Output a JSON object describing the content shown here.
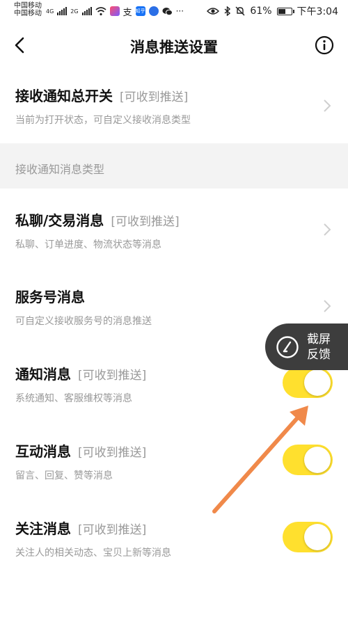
{
  "status_bar": {
    "carrier_1": "中国移动",
    "carrier_2": "中国移动",
    "net_1": "4G",
    "net_2": "2G",
    "battery_percent": "61%",
    "battery_level": 0.61,
    "time": "下午3:04",
    "app_icons": [
      "kuaishou-icon",
      "alipay-icon",
      "zhihu-icon",
      "music-icon",
      "wechat-icon"
    ],
    "more": "···",
    "zhihu_label": "知乎",
    "alipay_label": "支"
  },
  "nav": {
    "title": "消息推送设置"
  },
  "master": {
    "title": "接收通知总开关",
    "tag": "[可收到推送]",
    "subtitle": "当前为打开状态，可自定义接收消息类型"
  },
  "section": {
    "header": "接收通知消息类型"
  },
  "items": [
    {
      "title": "私聊/交易消息",
      "tag": "[可收到推送]",
      "subtitle": "私聊、订单进度、物流状态等消息",
      "control": "chevron"
    },
    {
      "title": "服务号消息",
      "tag": "",
      "subtitle": "可自定义接收服务号的消息推送",
      "control": "chevron"
    },
    {
      "title": "通知消息",
      "tag": "[可收到推送]",
      "subtitle": "系统通知、客服维权等消息",
      "control": "toggle",
      "on": true
    },
    {
      "title": "互动消息",
      "tag": "[可收到推送]",
      "subtitle": "留言、回复、赞等消息",
      "control": "toggle",
      "on": true
    },
    {
      "title": "关注消息",
      "tag": "[可收到推送]",
      "subtitle": "关注人的相关动态、宝贝上新等消息",
      "control": "toggle",
      "on": true
    }
  ],
  "feedback": {
    "line1": "截屏",
    "line2": "反馈"
  },
  "colors": {
    "toggle_on": "#ffe02e",
    "arrow": "#f0894a",
    "section_bg": "#f3f3f3",
    "feedback_bg": "#3d3d3d"
  }
}
